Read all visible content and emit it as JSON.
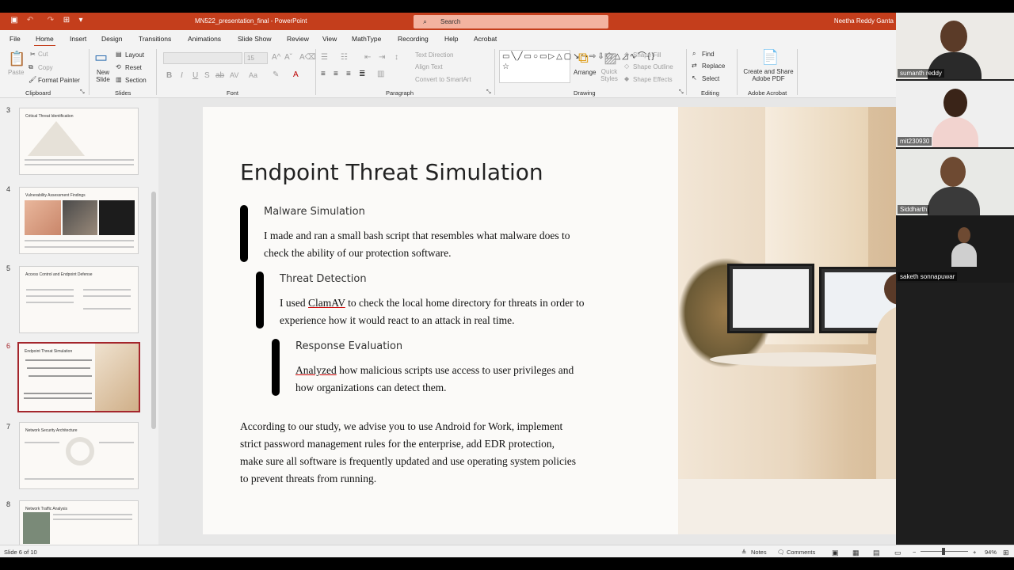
{
  "app": {
    "title": "MN522_presentation_final  -  PowerPoint",
    "user": "Neetha Reddy Ganta",
    "search_placeholder": "Search"
  },
  "menu": {
    "tabs": [
      "File",
      "Home",
      "Insert",
      "Design",
      "Transitions",
      "Animations",
      "Slide Show",
      "Review",
      "View",
      "MathType",
      "Recording",
      "Help",
      "Acrobat"
    ],
    "active": "Home"
  },
  "ribbon": {
    "clipboard": {
      "paste": "Paste",
      "cut": "Cut",
      "copy": "Copy",
      "format_painter": "Format Painter",
      "label": "Clipboard"
    },
    "slides": {
      "new_slide": "New Slide",
      "layout": "Layout",
      "reset": "Reset",
      "section": "Section",
      "label": "Slides"
    },
    "font": {
      "label": "Font",
      "font_size": "15"
    },
    "paragraph": {
      "text_direction": "Text Direction",
      "align_text": "Align Text",
      "smartart": "Convert to SmartArt",
      "label": "Paragraph"
    },
    "drawing": {
      "arrange": "Arrange",
      "quick_styles": "Quick Styles",
      "shape_fill": "Shape Fill",
      "shape_outline": "Shape Outline",
      "shape_effects": "Shape Effects",
      "label": "Drawing"
    },
    "editing": {
      "find": "Find",
      "replace": "Replace",
      "select": "Select",
      "label": "Editing"
    },
    "acrobat": {
      "create_share": "Create and Share Adobe PDF",
      "label": "Adobe Acrobat"
    }
  },
  "thumbnails": [
    {
      "num": "3",
      "title": "Critical Threat Identification"
    },
    {
      "num": "4",
      "title": "Vulnerability Assessment Findings"
    },
    {
      "num": "5",
      "title": "Access Control and Endpoint Defense"
    },
    {
      "num": "6",
      "title": "Endpoint Threat Simulation",
      "selected": true
    },
    {
      "num": "7",
      "title": "Network Security Architecture"
    },
    {
      "num": "8",
      "title": "Network Traffic Analysis"
    }
  ],
  "slide": {
    "title": "Endpoint Threat Simulation",
    "sections": [
      {
        "heading": "Malware Simulation",
        "line1": "I made and ran a small bash script that resembles what malware does to",
        "line2": "check the ability of our protection software."
      },
      {
        "heading": "Threat Detection",
        "line1_a": "I used ",
        "line1_b": "ClamAV",
        "line1_c": " to check the local home directory for threats in order to",
        "line2": "experience how it would react to an attack in real time."
      },
      {
        "heading": "Response Evaluation",
        "line1_a": "Analyzed",
        "line1_b": " how malicious scripts use access to user privileges and",
        "line2": "how organizations can detect them."
      }
    ],
    "conclusion": [
      "According to our study, we advise you to use Android for Work, implement",
      "strict password management rules for the enterprise, add EDR protection,",
      "make sure all software is frequently updated and use operating system policies",
      "to prevent threats from running."
    ]
  },
  "participants": [
    {
      "name": "sumanth reddy"
    },
    {
      "name": "mit230930"
    },
    {
      "name": "Siddharth"
    },
    {
      "name": "saketh sonnapuwar"
    }
  ],
  "status": {
    "slide_of": "Slide 6 of 10",
    "notes": "Notes",
    "comments": "Comments",
    "zoom": "94%"
  },
  "colors": {
    "accent": "#c43e1c",
    "selected_border": "#a4262c"
  }
}
